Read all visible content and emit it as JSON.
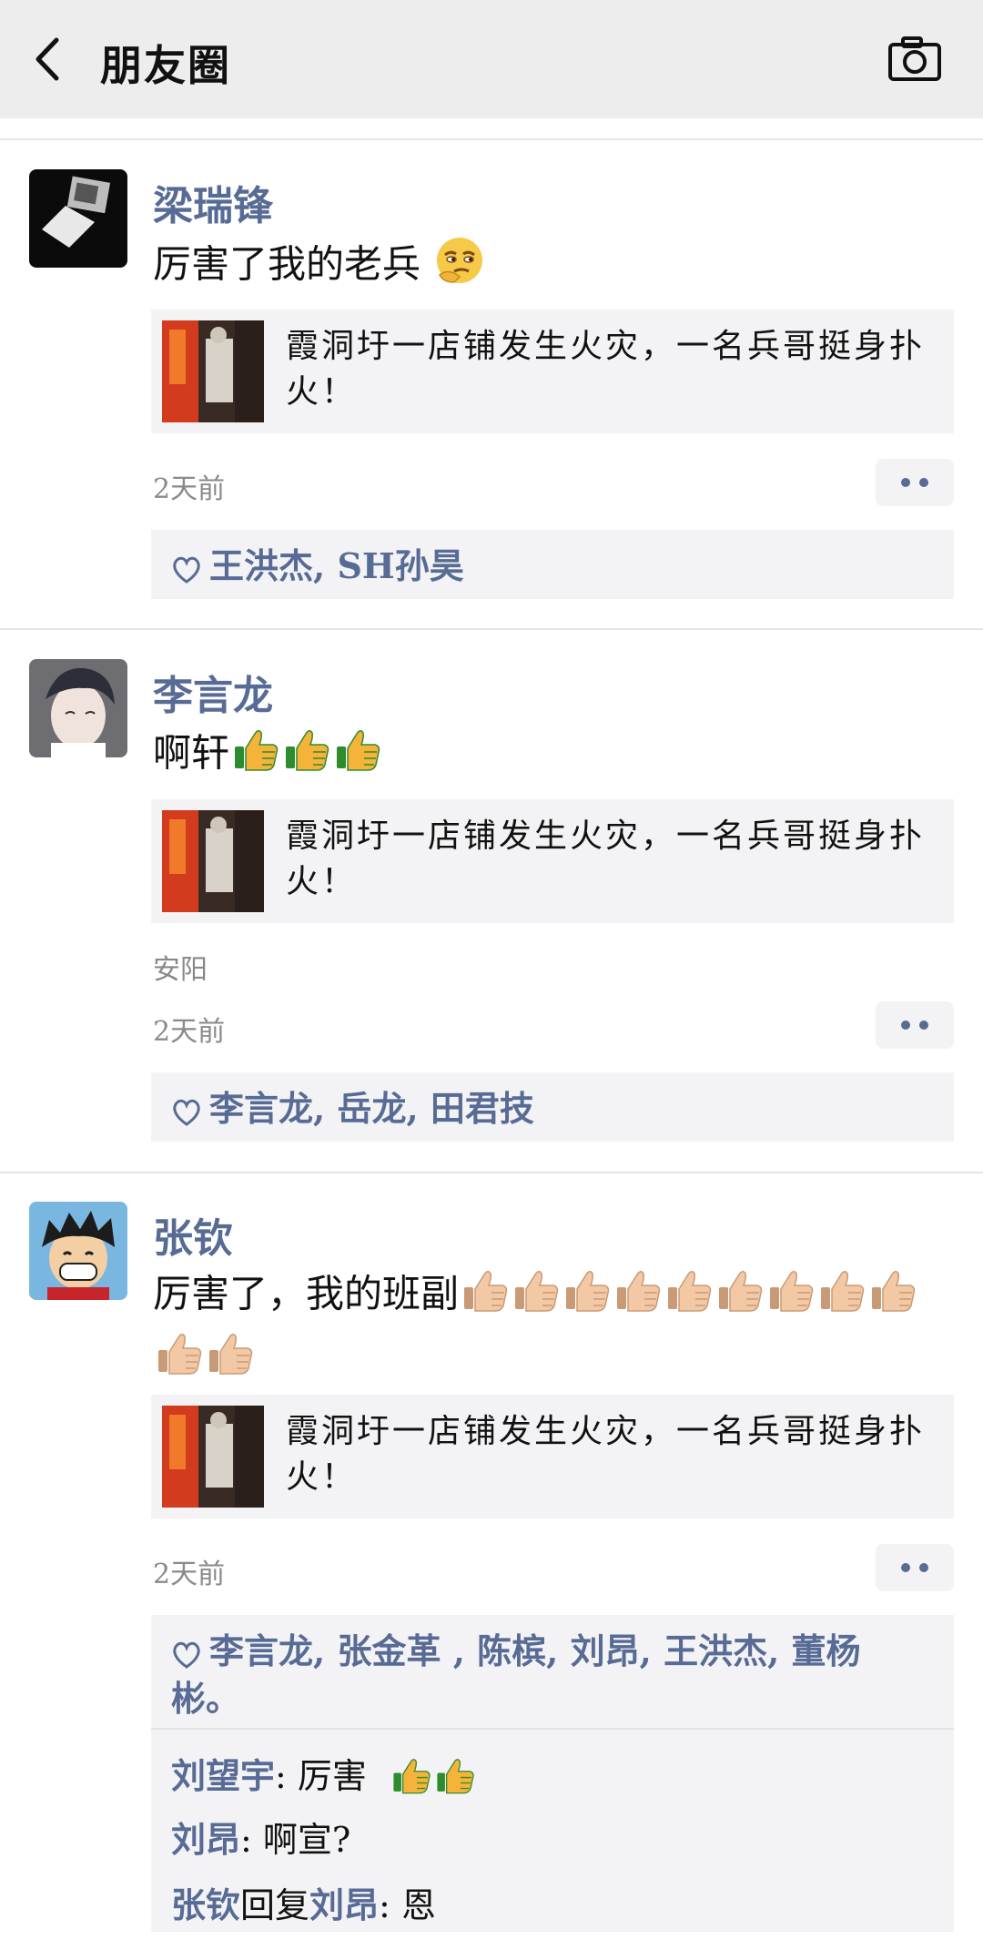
{
  "header": {
    "title": "朋友圈",
    "back_icon": "chevron-left-icon",
    "camera_icon": "camera-icon"
  },
  "posts": [
    {
      "name": "梁瑞锋",
      "text": "厉害了我的老兵",
      "emoji": "thinking-smirk-emoji",
      "link_text": "霞洞圩一店铺发生火灾，一名兵哥挺身扑火！",
      "time": "2天前",
      "likes": "王洪杰, SH孙昊"
    },
    {
      "name": "李言龙",
      "text": "啊轩",
      "emoji": "thumbs-up-emoji",
      "link_text": "霞洞圩一店铺发生火灾，一名兵哥挺身扑火！",
      "location": "安阳",
      "time": "2天前",
      "likes": "李言龙, 岳龙, 田君技"
    },
    {
      "name": "张钦",
      "text": "厉害了，我的班副",
      "emoji": "thumbs-up-emoji",
      "link_text": "霞洞圩一店铺发生火灾，一名兵哥挺身扑火！",
      "time": "2天前",
      "likes": "李言龙, 张金革 , 陈槟, 刘昂, 王洪杰, 董杨彬。",
      "comments": [
        {
          "who": "刘望宇",
          "sep": ": ",
          "text": "厉害"
        },
        {
          "who": "刘昂",
          "sep": ": ",
          "text": "啊宣?"
        },
        {
          "who": "张钦",
          "reply_word": "回复",
          "who2": "刘昂",
          "sep": ": ",
          "text": "恩"
        }
      ]
    }
  ],
  "colors": {
    "link_blue": "#576b95",
    "card_bg": "#f3f3f5",
    "header_bg": "#ededed"
  }
}
